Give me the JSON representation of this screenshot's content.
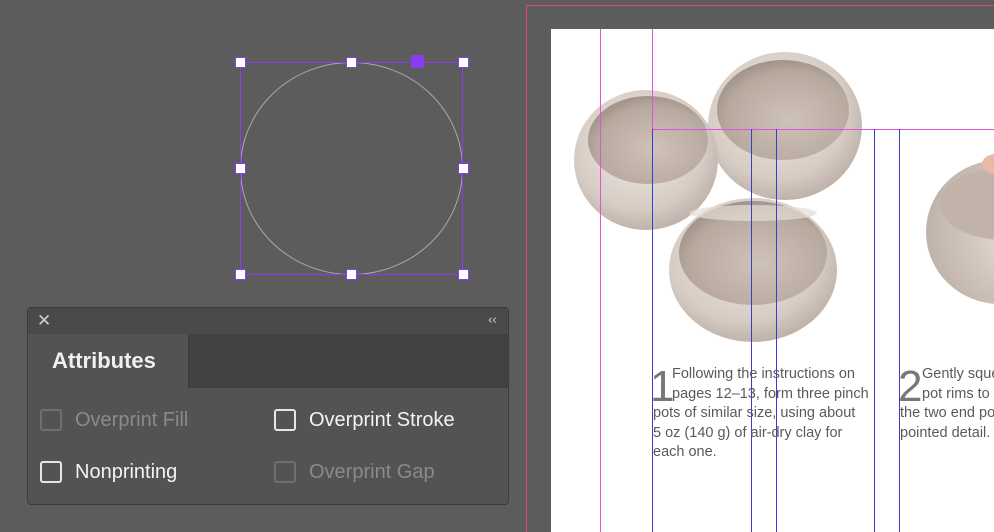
{
  "panel": {
    "close_icon": "✕",
    "collapse_icon": "‹‹",
    "tab_title": "Attributes",
    "options": {
      "overprint_fill": {
        "label": "Overprint Fill",
        "checked": false,
        "enabled": false
      },
      "overprint_stroke": {
        "label": "Overprint Stroke",
        "checked": false,
        "enabled": true
      },
      "nonprinting": {
        "label": "Nonprinting",
        "checked": false,
        "enabled": true
      },
      "overprint_gap": {
        "label": "Overprint Gap",
        "checked": false,
        "enabled": false
      }
    }
  },
  "document": {
    "step1": {
      "number": "1",
      "lines": [
        "Following the instructions on",
        "pages 12–13, form three pinch",
        "pots of similar size, using about",
        "5 oz (140 g) of air-dry clay for",
        "each one."
      ]
    },
    "step2": {
      "number": "2",
      "lines": [
        "Gently sque",
        "pot rims to",
        "the two end po",
        "pointed detail."
      ]
    }
  },
  "colors": {
    "selection": "#8a3cf0",
    "margin_guide": "#e34ee3",
    "column_guide": "#3c3ccc",
    "bleed_guide": "#e0476c",
    "canvas": "#5c5c5c",
    "panel": "#535353"
  }
}
